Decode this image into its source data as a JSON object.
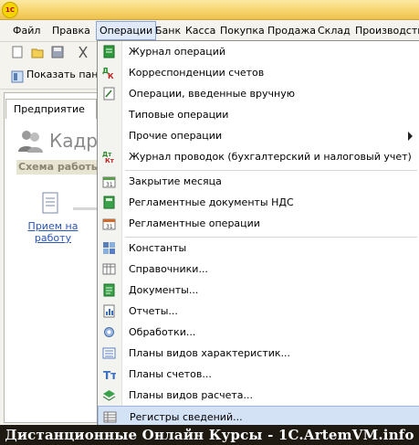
{
  "app": {
    "logo_text": "1С"
  },
  "menubar": {
    "items": [
      "Файл",
      "Правка",
      "Операции",
      "Банк",
      "Касса",
      "Покупка",
      "Продажа",
      "Склад",
      "Производство"
    ],
    "active_index": 2
  },
  "toolbar2": {
    "show_panel_label": "Показать пане"
  },
  "left_panel": {
    "tab_label": "Предприятие",
    "heading": "Кадр",
    "scheme_label": "Схема работы",
    "doc_link": "Прием на работу"
  },
  "dropdown": {
    "items": [
      {
        "label": "Журнал операций",
        "icon": "journal-icon"
      },
      {
        "label": "Корреспонденции счетов",
        "icon": "dk-icon"
      },
      {
        "label": "Операции, введенные вручную",
        "icon": "manual-op-icon"
      },
      {
        "label": "Типовые операции",
        "icon": ""
      },
      {
        "label": "Прочие операции",
        "icon": "",
        "submenu": true
      },
      {
        "label": "Журнал проводок (бухгалтерский и налоговый учет)",
        "icon": "dt-kt-icon"
      },
      {
        "label": "Закрытие месяца",
        "icon": "calendar-check-icon"
      },
      {
        "label": "Регламентные документы НДС",
        "icon": "document-green-icon"
      },
      {
        "label": "Регламентные операции",
        "icon": "calendar-31-icon"
      },
      {
        "label": "Константы",
        "icon": "constants-icon"
      },
      {
        "label": "Справочники...",
        "icon": "catalog-icon"
      },
      {
        "label": "Документы...",
        "icon": "documents-icon"
      },
      {
        "label": "Отчеты...",
        "icon": "reports-icon"
      },
      {
        "label": "Обработки...",
        "icon": "processing-icon"
      },
      {
        "label": "Планы видов характеристик...",
        "icon": "char-plans-icon"
      },
      {
        "label": "Планы счетов...",
        "icon": "accounts-plan-icon"
      },
      {
        "label": "Планы видов расчета...",
        "icon": "calc-plans-icon"
      },
      {
        "label": "Регистры сведений...",
        "icon": "registers-icon"
      }
    ],
    "selected_index": 17
  },
  "banner": {
    "text": "Дистанционные Онлайн Курсы - 1C.ArtemVM.info"
  }
}
